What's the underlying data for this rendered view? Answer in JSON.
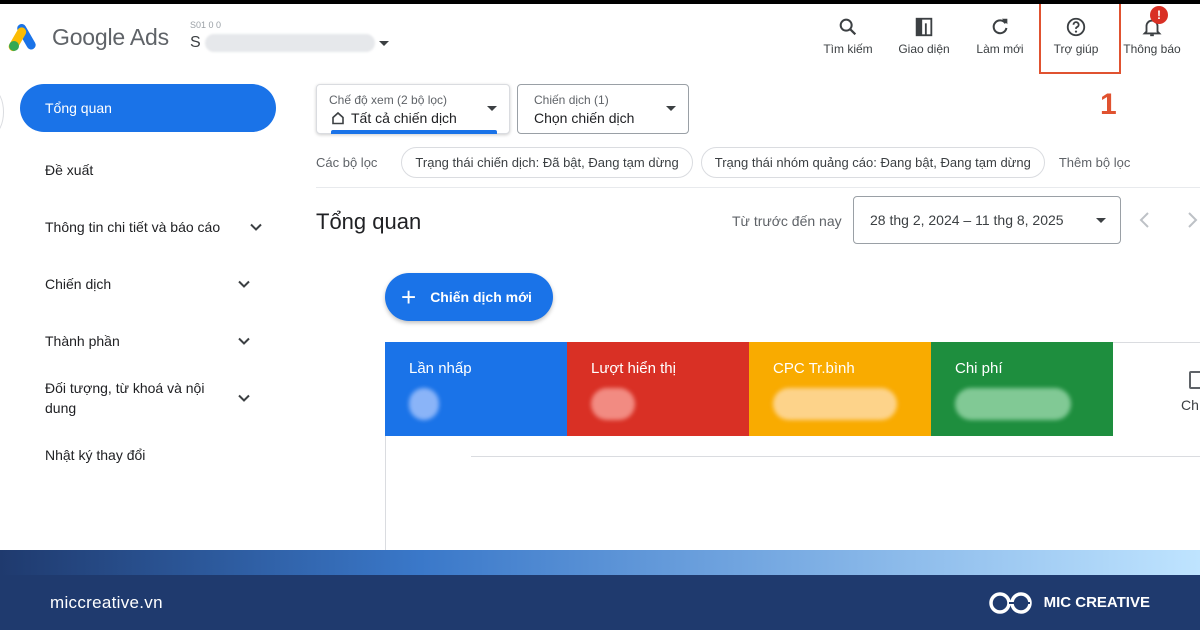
{
  "header": {
    "logo_text": "Google Ads",
    "account_id_label": "S01 0 0",
    "account_initial": "S",
    "toolbar": [
      {
        "label": "Tìm kiếm",
        "icon": "search-icon"
      },
      {
        "label": "Giao diện",
        "icon": "appearance-icon"
      },
      {
        "label": "Làm mới",
        "icon": "refresh-icon"
      },
      {
        "label": "Trợ giúp",
        "icon": "help-icon"
      },
      {
        "label": "Thông báo",
        "icon": "bell-icon"
      }
    ],
    "notification_badge": "!",
    "step_marker": "1"
  },
  "sidebar": {
    "items": [
      {
        "label": "Tổng quan",
        "active": true
      },
      {
        "label": "Đề xuất"
      },
      {
        "label": "Thông tin chi tiết và báo cáo"
      },
      {
        "label": "Chiến dịch"
      },
      {
        "label": "Thành phần"
      },
      {
        "label": "Đối tượng, từ khoá và nội dung"
      },
      {
        "label": "Nhật ký thay đổi"
      }
    ]
  },
  "filters": {
    "view_mode_label": "Chế độ xem (2 bộ lọc)",
    "view_mode_value": "Tất cả chiến dịch",
    "campaign_label": "Chiến dịch (1)",
    "campaign_value": "Chọn chiến dịch",
    "filter_row_label": "Các bộ lọc",
    "chips": [
      "Trạng thái chiến dịch: Đã bật, Đang tạm dừng",
      "Trạng thái nhóm quảng cáo: Đang bật, Đang tạm dừng"
    ],
    "add_filter": "Thêm bộ lọc"
  },
  "main": {
    "title": "Tổng quan",
    "date_prefix": "Từ trước đến nay",
    "date_range": "28 thg 2, 2024 – 11 thg 8, 2025",
    "new_campaign_button": "Chiến dịch mới",
    "metrics": [
      {
        "label": "Lần nhấp",
        "color": "#1a73e8"
      },
      {
        "label": "Lượt hiển thị",
        "color": "#d93025"
      },
      {
        "label": "CPC Tr.bình",
        "color": "#f9ab00"
      },
      {
        "label": "Chi phí",
        "color": "#1e8e3e"
      }
    ],
    "chart_card_label": "Ch"
  },
  "footer": {
    "site": "miccreative.vn",
    "brand": "MIC CREATIVE"
  },
  "colors": {
    "primary": "#1a73e8",
    "highlight": "#e05230",
    "footer_bg": "#1f3a6e"
  }
}
